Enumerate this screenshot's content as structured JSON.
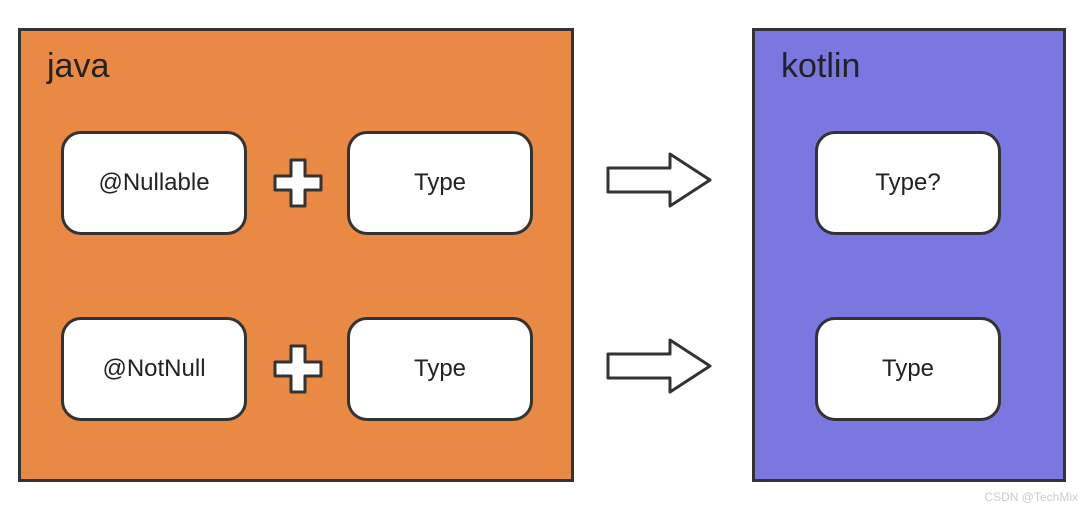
{
  "java": {
    "title": "java",
    "row1": {
      "annotation": "@Nullable",
      "type": "Type"
    },
    "row2": {
      "annotation": "@NotNull",
      "type": "Type"
    }
  },
  "kotlin": {
    "title": "kotlin",
    "row1": {
      "type": "Type?"
    },
    "row2": {
      "type": "Type"
    }
  },
  "watermark": "CSDN @TechMix"
}
